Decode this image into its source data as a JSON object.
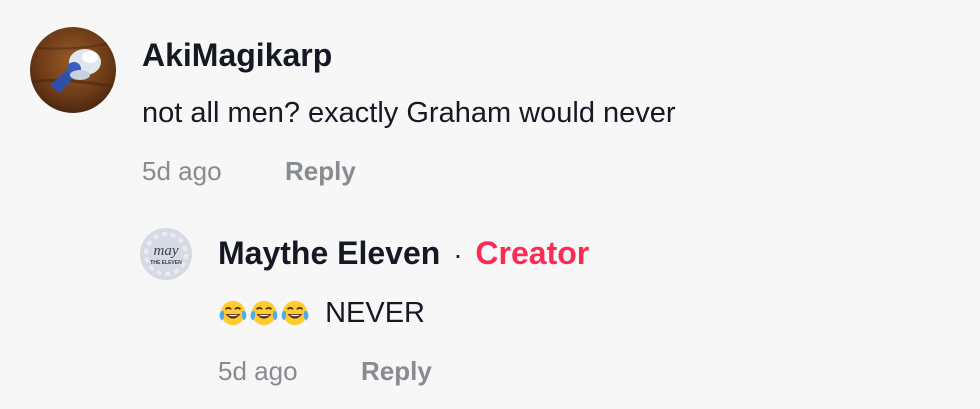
{
  "comments": [
    {
      "username": "AkiMagikarp",
      "text": "not all men? exactly Graham would never",
      "time": "5d ago",
      "reply_label": "Reply"
    }
  ],
  "reply": {
    "username": "Maythe Eleven",
    "separator": "·",
    "badge": "Creator",
    "emoji": "😂😂😂",
    "text": "NEVER",
    "time": "5d ago",
    "reply_label": "Reply",
    "avatar_text_top": "may",
    "avatar_text_bottom": "THE ELEVEN"
  },
  "colors": {
    "background": "#f7f7f7",
    "primary_text": "#161823",
    "secondary_text": "#8a8b91",
    "creator_badge": "#fe2c55"
  },
  "icons": {
    "emoji": "face-with-tears-of-joy-icon"
  }
}
